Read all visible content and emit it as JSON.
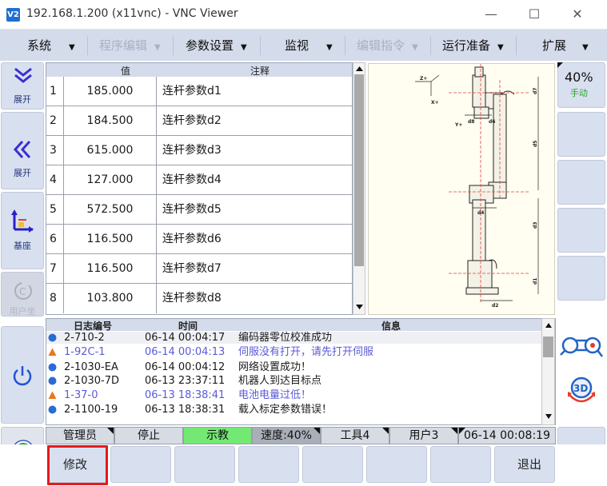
{
  "window": {
    "title": "192.168.1.200 (x11vnc) - VNC Viewer",
    "logo": "V2",
    "controls": [
      "—",
      "☐",
      "✕"
    ]
  },
  "menu": [
    {
      "label": "系统",
      "enabled": true
    },
    {
      "label": "程序编辑",
      "enabled": false
    },
    {
      "label": "参数设置",
      "enabled": true
    },
    {
      "label": "监视",
      "enabled": true
    },
    {
      "label": "编辑指令",
      "enabled": false
    },
    {
      "label": "运行准备",
      "enabled": true
    },
    {
      "label": "扩展",
      "enabled": true
    }
  ],
  "sidebar": {
    "expand1": "展开",
    "expand2": "展开",
    "base": "基座",
    "coord": "用户坐"
  },
  "params": {
    "headers": {
      "value": "值",
      "comment": "注释"
    },
    "rows": [
      {
        "idx": "1",
        "value": "185.000",
        "comment": "连杆参数d1"
      },
      {
        "idx": "2",
        "value": "184.500",
        "comment": "连杆参数d2"
      },
      {
        "idx": "3",
        "value": "615.000",
        "comment": "连杆参数d3"
      },
      {
        "idx": "4",
        "value": "127.000",
        "comment": "连杆参数d4"
      },
      {
        "idx": "5",
        "value": "572.500",
        "comment": "连杆参数d5"
      },
      {
        "idx": "6",
        "value": "116.500",
        "comment": "连杆参数d6"
      },
      {
        "idx": "7",
        "value": "116.500",
        "comment": "连杆参数d7"
      },
      {
        "idx": "8",
        "value": "103.800",
        "comment": "连杆参数d8"
      }
    ]
  },
  "diagram": {
    "labels": [
      "Z+",
      "X+",
      "Y+",
      "d8",
      "d6",
      "d7",
      "d5",
      "d4",
      "d3",
      "d1",
      "d2"
    ]
  },
  "right": {
    "speed": "40%",
    "mode": "手动"
  },
  "log": {
    "headers": {
      "code": "日志编号",
      "time": "时间",
      "msg": "信息"
    },
    "rows": [
      {
        "type": "info",
        "code": "2-710-2",
        "time": "06-14 00:04:17",
        "msg": "编码器零位校准成功"
      },
      {
        "type": "warn",
        "code": "1-92C-1",
        "time": "06-14 00:04:13",
        "msg": "伺服没有打开，请先打开伺服"
      },
      {
        "type": "info",
        "code": "2-1030-EA",
        "time": "06-14 00:04:12",
        "msg": "网络设置成功！"
      },
      {
        "type": "info",
        "code": "2-1030-7D",
        "time": "06-13 23:37:11",
        "msg": "机器人到达目标点"
      },
      {
        "type": "warn",
        "code": "1-37-0",
        "time": "06-13 18:38:41",
        "msg": "电池电量过低！"
      },
      {
        "type": "info",
        "code": "2-1100-19",
        "time": "06-13 18:38:31",
        "msg": "载入标定参数错误！"
      }
    ]
  },
  "status": {
    "user": "管理员",
    "run": "停止",
    "mode": "示教",
    "speed": "速度:40%",
    "tool": "工具4",
    "frame": "用户3",
    "clock": "06-14 00:08:19"
  },
  "bottom": {
    "modify": "修改",
    "exit": "退出"
  },
  "colors": {
    "menubar": "#d4dbea",
    "button": "#d8e0f0",
    "mode": "#74e874",
    "speed": "#a9aeb8",
    "highlight": "#e3191d",
    "power": "#1aa33a"
  }
}
